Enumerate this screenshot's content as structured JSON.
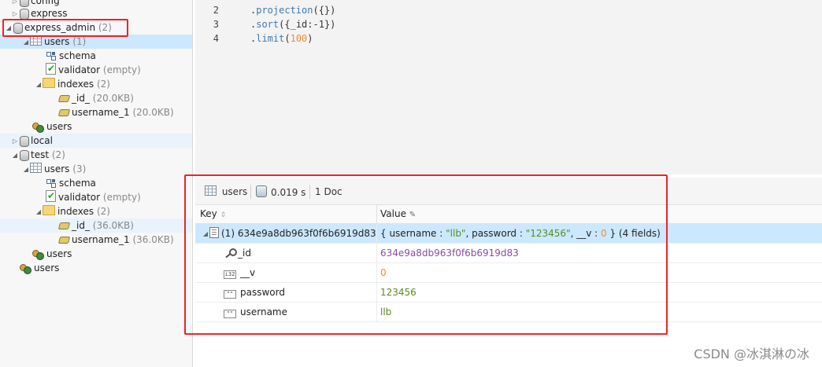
{
  "tree": {
    "config": {
      "label": "config"
    },
    "express": {
      "label": "express"
    },
    "express_admin": {
      "label": "express_admin",
      "count": "(2)"
    },
    "ea_users": {
      "label": "users",
      "count": "(1)"
    },
    "ea_schema": {
      "label": "schema"
    },
    "ea_validator": {
      "label": "validator",
      "note": "(empty)"
    },
    "ea_indexes": {
      "label": "indexes",
      "count": "(2)"
    },
    "ea_idx_id": {
      "label": "_id_",
      "size": "(20.0KB)"
    },
    "ea_idx_username": {
      "label": "username_1",
      "size": "(20.0KB)"
    },
    "ea_db_users": {
      "label": "users"
    },
    "local": {
      "label": "local"
    },
    "test": {
      "label": "test",
      "count": "(2)"
    },
    "t_users": {
      "label": "users",
      "count": "(3)"
    },
    "t_schema": {
      "label": "schema"
    },
    "t_validator": {
      "label": "validator",
      "note": "(empty)"
    },
    "t_indexes": {
      "label": "indexes",
      "count": "(2)"
    },
    "t_idx_id": {
      "label": "_id_",
      "size": "(36.0KB)"
    },
    "t_idx_username": {
      "label": "username_1",
      "size": "(36.0KB)"
    },
    "t_db_users": {
      "label": "users"
    },
    "root_users": {
      "label": "users"
    }
  },
  "editor": {
    "lines": [
      {
        "num": "2",
        "prefix": ".",
        "fn": "projection",
        "args": "({})"
      },
      {
        "num": "3",
        "prefix": ".",
        "fn": "sort",
        "args": "({_id:-1})"
      },
      {
        "num": "4",
        "prefix": ".",
        "fn": "limit",
        "args_open": "(",
        "arg_num": "100",
        "args_close": ")"
      }
    ]
  },
  "results": {
    "collection": "users",
    "time": "0.019 s",
    "doc_count": "1 Doc",
    "col_key": "Key",
    "col_value": "Value",
    "rows": [
      {
        "key": "(1) 634e9a8db963f0f6b6919d83",
        "value": "{ username : \"llb\", password : \"123456\", __v : 0 } (4 fields)"
      },
      {
        "key": "_id",
        "value": "634e9a8db963f0f6b6919d83"
      },
      {
        "key": "__v",
        "value": "0"
      },
      {
        "key": "password",
        "value": "123456"
      },
      {
        "key": "username",
        "value": "llb"
      }
    ],
    "value_parts": {
      "open": "{ username : ",
      "username": "\"llb\"",
      "mid1": ", password : ",
      "password": "\"123456\"",
      "mid2": ", __v : ",
      "v": "0",
      "close": " } (4 fields)"
    }
  },
  "watermark": "CSDN @冰淇淋の冰",
  "colors": {
    "accent_red": "#e8262b",
    "selection": "#cce8ff",
    "id_value": "#8b4aa8",
    "number_value": "#f08c2a",
    "string_value": "#5b8a1f"
  }
}
